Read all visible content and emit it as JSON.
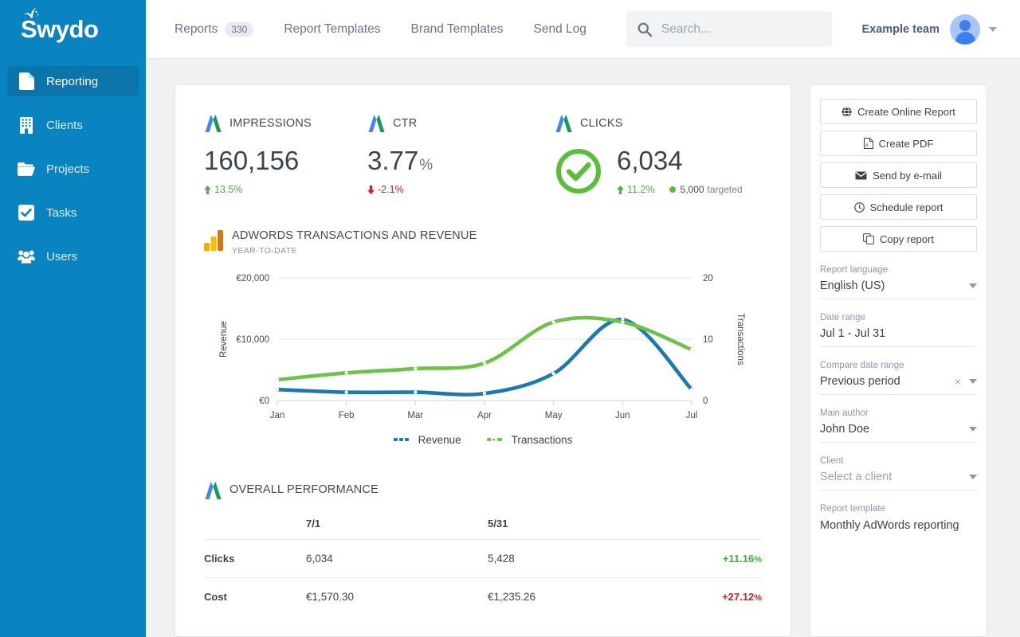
{
  "sidebar": {
    "logo_text": "Swydo",
    "items": [
      {
        "label": "Reporting",
        "icon": "document-icon",
        "active": true
      },
      {
        "label": "Clients",
        "icon": "building-icon",
        "active": false
      },
      {
        "label": "Projects",
        "icon": "folder-icon",
        "active": false
      },
      {
        "label": "Tasks",
        "icon": "checkbox-icon",
        "active": false
      },
      {
        "label": "Users",
        "icon": "users-icon",
        "active": false
      }
    ]
  },
  "topbar": {
    "nav": [
      {
        "label": "Reports",
        "badge": "330"
      },
      {
        "label": "Report Templates",
        "badge": ""
      },
      {
        "label": "Brand Templates",
        "badge": ""
      },
      {
        "label": "Send Log",
        "badge": ""
      }
    ],
    "search": {
      "placeholder": "Search...",
      "value": ""
    },
    "team_name": "Example team"
  },
  "kpis": [
    {
      "title": "IMPRESSIONS",
      "value": "160,156",
      "unit": "",
      "delta": "13.5%",
      "delta_dir": "up",
      "has_check": false,
      "target": "",
      "target_suffix": ""
    },
    {
      "title": "CTR",
      "value": "3.77",
      "unit": "%",
      "delta": "-2.1%",
      "delta_dir": "down",
      "has_check": false,
      "target": "",
      "target_suffix": ""
    },
    {
      "title": "CLICKS",
      "value": "6,034",
      "unit": "",
      "delta": "11.2%",
      "delta_dir": "up",
      "has_check": true,
      "target": "5,000",
      "target_suffix": "targeted"
    }
  ],
  "chart_widget": {
    "title": "ADWORDS TRANSACTIONS AND REVENUE",
    "subtitle": "YEAR-TO-DATE"
  },
  "chart_data": {
    "type": "line",
    "title": "ADWORDS TRANSACTIONS AND REVENUE",
    "subtitle": "YEAR-TO-DATE",
    "x": [
      "Jan",
      "Feb",
      "Mar",
      "Apr",
      "May",
      "Jun",
      "Jul"
    ],
    "xlabel": "",
    "ylabel": "Revenue",
    "y2label": "Transactions",
    "ylim": [
      0,
      20000
    ],
    "y2lim": [
      0,
      20
    ],
    "yticks": [
      "€0",
      "€10,000",
      "€20,000"
    ],
    "ytick_values": [
      0,
      10000,
      20000
    ],
    "y2ticks": [
      "0",
      "10",
      "20"
    ],
    "y2tick_values": [
      0,
      10,
      20
    ],
    "grid": true,
    "legend_position": "bottom",
    "series": [
      {
        "name": "Revenue",
        "color": "#1b79ad",
        "axis": "left",
        "values": [
          1800,
          1350,
          1350,
          1150,
          4400,
          13200,
          1800
        ]
      },
      {
        "name": "Transactions",
        "color": "#6cc24a",
        "axis": "right",
        "values": [
          3.4,
          4.5,
          5.2,
          6.1,
          12.8,
          12.8,
          8.3
        ]
      }
    ]
  },
  "table_widget": {
    "title": "OVERALL PERFORMANCE",
    "columns": [
      "",
      "7/1",
      "5/31",
      ""
    ],
    "rows": [
      {
        "metric": "Clicks",
        "a": "6,034",
        "b": "5,428",
        "delta": "+11.16",
        "delta_unit": "%",
        "delta_dir": "pos"
      },
      {
        "metric": "Cost",
        "a": "€1,570.30",
        "b": "€1,235.26",
        "delta": "+27.12",
        "delta_unit": "%",
        "delta_dir": "neg"
      }
    ]
  },
  "side_panel": {
    "buttons": [
      {
        "label": "Create Online Report",
        "icon": "globe-icon"
      },
      {
        "label": "Create PDF",
        "icon": "pdf-icon"
      },
      {
        "label": "Send by e-mail",
        "icon": "envelope-icon"
      },
      {
        "label": "Schedule report",
        "icon": "clock-icon"
      },
      {
        "label": "Copy report",
        "icon": "copy-icon"
      }
    ],
    "fields": [
      {
        "label": "Report language",
        "value": "English (US)",
        "kind": "select",
        "muted": false,
        "clearable": false
      },
      {
        "label": "Date range",
        "value": "Jul 1 - Jul 31",
        "kind": "text",
        "muted": false,
        "clearable": false
      },
      {
        "label": "Compare date range",
        "value": "Previous period",
        "kind": "select",
        "muted": false,
        "clearable": true,
        "clear_glyph": "×"
      },
      {
        "label": "Main author",
        "value": "John Doe",
        "kind": "select",
        "muted": false,
        "clearable": false
      },
      {
        "label": "Client",
        "value": "Select a client",
        "kind": "select",
        "muted": true,
        "clearable": false
      },
      {
        "label": "Report template",
        "value": "Monthly AdWords reporting",
        "kind": "static",
        "muted": false,
        "clearable": false
      }
    ]
  },
  "colors": {
    "sidebar_bg": "#0a84c1",
    "sidebar_active": "#0b74ab",
    "revenue_line": "#1b79ad",
    "transactions_line": "#6cc24a",
    "positive": "#3db23d",
    "negative": "#e01b1b",
    "check_green": "#5bbd3a"
  }
}
